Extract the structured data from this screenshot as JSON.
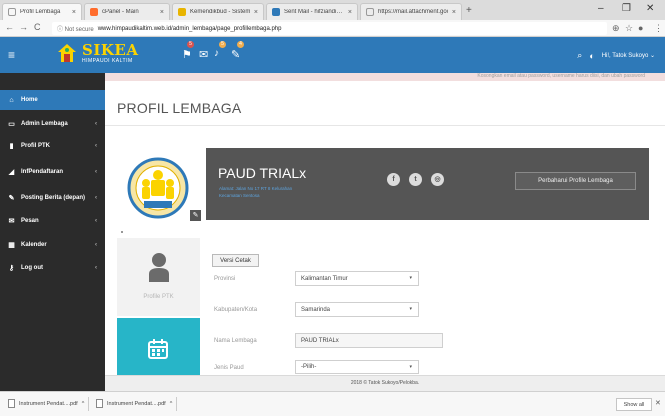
{
  "browser": {
    "tabs": [
      {
        "label": "Profil Lembaga",
        "favicon_color": "#ffffff",
        "active": true
      },
      {
        "label": "cPanel - Main",
        "favicon_color": "#ff6c2c",
        "active": false
      },
      {
        "label": "Kemendikbud - Sistem…",
        "favicon_color": "#e8b400",
        "active": false
      },
      {
        "label": "Sent Mail - hifziandi…",
        "favicon_color": "#2e79b8",
        "active": false
      },
      {
        "label": "https://mail.attachment.google…",
        "favicon_color": "#ffffff",
        "active": false
      }
    ],
    "tab_close_glyph": "×",
    "new_tab_glyph": "+",
    "window_controls": [
      "–",
      "❐",
      "✕"
    ],
    "nav": {
      "back": "←",
      "forward": "→",
      "reload": "C"
    },
    "security_label": "ⓘ Not secure",
    "url": "www.himpaudikaltim.web.id/admin_lembaga/page_profillembaga.php",
    "address_icons": [
      "zoom-icon",
      "star-icon",
      "extension-icon",
      "menu-icon"
    ]
  },
  "app": {
    "hamburger_glyph": "≡",
    "logo_text": "SIKEA",
    "logo_sub": "HIMPAUDI KALTIM",
    "nav_icons": [
      {
        "name": "flag-icon",
        "glyph": "⚑",
        "badge": "5",
        "badge_color": "#d9534f"
      },
      {
        "name": "envelope-icon",
        "glyph": "✉",
        "badge": "",
        "badge_color": "#2e79b8"
      },
      {
        "name": "bell-icon",
        "glyph": "🔔",
        "badge": "5",
        "badge_color": "#f0ad4e"
      },
      {
        "name": "tasks-icon",
        "glyph": "✎",
        "badge": "4",
        "badge_color": "#f0ad4e"
      }
    ],
    "search_glyph": "⌕",
    "user_icon_glyph": "◐",
    "user_label": "Hi!, Tatok Sukoyo ⌄",
    "colors": {
      "primary": "#2e79b8",
      "sidebar": "#2b2b2b",
      "logo_yellow": "#fbd300",
      "teal": "#27b5c8"
    }
  },
  "sidebar": {
    "items": [
      {
        "label": "Home",
        "icon": "home-icon",
        "glyph": "⌂",
        "has_caret": false
      },
      {
        "label": "Admin Lembaga",
        "icon": "monitor-icon",
        "glyph": "▭",
        "has_caret": true
      },
      {
        "label": "Profil PTK",
        "icon": "book-icon",
        "glyph": "▮",
        "has_caret": true
      },
      {
        "label": "InfPendaftaran",
        "icon": "chart-icon",
        "glyph": "◢",
        "has_caret": true
      },
      {
        "label": "Posting Berita (depan)",
        "icon": "pencil-icon",
        "glyph": "✎",
        "has_caret": true
      },
      {
        "label": "Pesan",
        "icon": "envelope-icon",
        "glyph": "✉",
        "has_caret": true
      },
      {
        "label": "Kalender",
        "icon": "calendar-icon",
        "glyph": "▦",
        "has_caret": true
      },
      {
        "label": "Log out",
        "icon": "key-icon",
        "glyph": "⚷",
        "has_caret": true
      }
    ],
    "caret_glyph": "‹"
  },
  "main": {
    "alert_text": "Kosongkan email atau password, username harus diisi, dan ubah password",
    "page_title": "PROFIL LEMBAGA",
    "institution": {
      "name": "PAUD TRIALx",
      "sub_lines": [
        "Alamat: Jalan No 17 RT 8 Kelurahan",
        "Kecamatan Sentosa"
      ],
      "edit_glyph": "✎"
    },
    "social_icons": [
      {
        "name": "facebook-icon",
        "glyph": "f"
      },
      {
        "name": "twitter-icon",
        "glyph": "t"
      },
      {
        "name": "instagram-icon",
        "glyph": "◎"
      }
    ],
    "update_button": "Perbaharui Profile Lembaga",
    "ptk_card_label": "Profile PTK",
    "print_button": "Versi Cetak",
    "form": [
      {
        "label": "Provinsi",
        "type": "select",
        "value": "Kalimantan Timur"
      },
      {
        "label": "Kabupaten/Kota",
        "type": "select",
        "value": "Samarinda"
      },
      {
        "label": "Nama Lembaga",
        "type": "input",
        "value": "PAUD TRIALx"
      },
      {
        "label": "Jenis Paud",
        "type": "select",
        "value": "-Pilih-"
      }
    ],
    "select_arrow": "▾"
  },
  "footer": {
    "text": "2018 © Tatok Sukoyo/Pelokba."
  },
  "downloads": {
    "items": [
      {
        "label": "Instrument Pendat....pdf",
        "caret": "^"
      },
      {
        "label": "Instrument Pendat....pdf",
        "caret": "^"
      }
    ],
    "show_all": "Show all",
    "close_glyph": "✕"
  }
}
